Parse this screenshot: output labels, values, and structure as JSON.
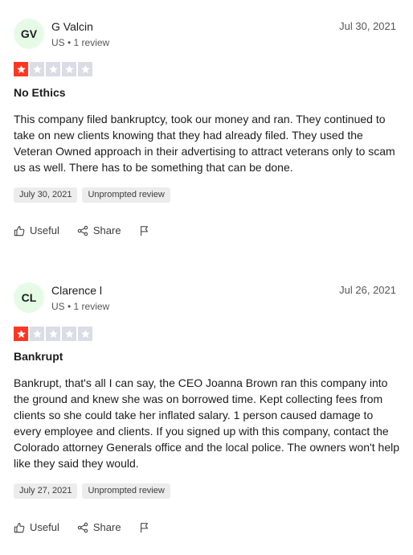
{
  "colors": {
    "star_filled": "#ff3722",
    "star_empty": "#dcdce6",
    "avatar1_bg": "#e6fbe6",
    "avatar2_bg": "#e6fbe6"
  },
  "reviews": [
    {
      "initials": "GV",
      "name": "G Valcin",
      "meta": "US • 1 review",
      "date": "Jul 30, 2021",
      "rating": 1,
      "title": "No Ethics",
      "body": "This company filed bankruptcy, took our money and ran. They continued to take on new clients knowing that they had already filed. They used the Veteran Owned approach in their advertising to attract veterans only to scam us as well. There has to be something that can be done.",
      "tag_date": "July 30, 2021",
      "tag_type": "Unprompted review",
      "useful_label": "Useful",
      "share_label": "Share"
    },
    {
      "initials": "CL",
      "name": "Clarence l",
      "meta": "US • 1 review",
      "date": "Jul 26, 2021",
      "rating": 1,
      "title": "Bankrupt",
      "body": "Bankrupt, that's all I can say, the CEO Joanna Brown ran this company into the ground and knew she was on borrowed time. Kept collecting fees from clients so she could take her inflated salary. 1 person caused damage to every employee and clients. If you signed up with this company, contact the Colorado attorney Generals office and the local police. The owners won't help like they said they would.",
      "tag_date": "July 27, 2021",
      "tag_type": "Unprompted review",
      "useful_label": "Useful",
      "share_label": "Share"
    }
  ]
}
